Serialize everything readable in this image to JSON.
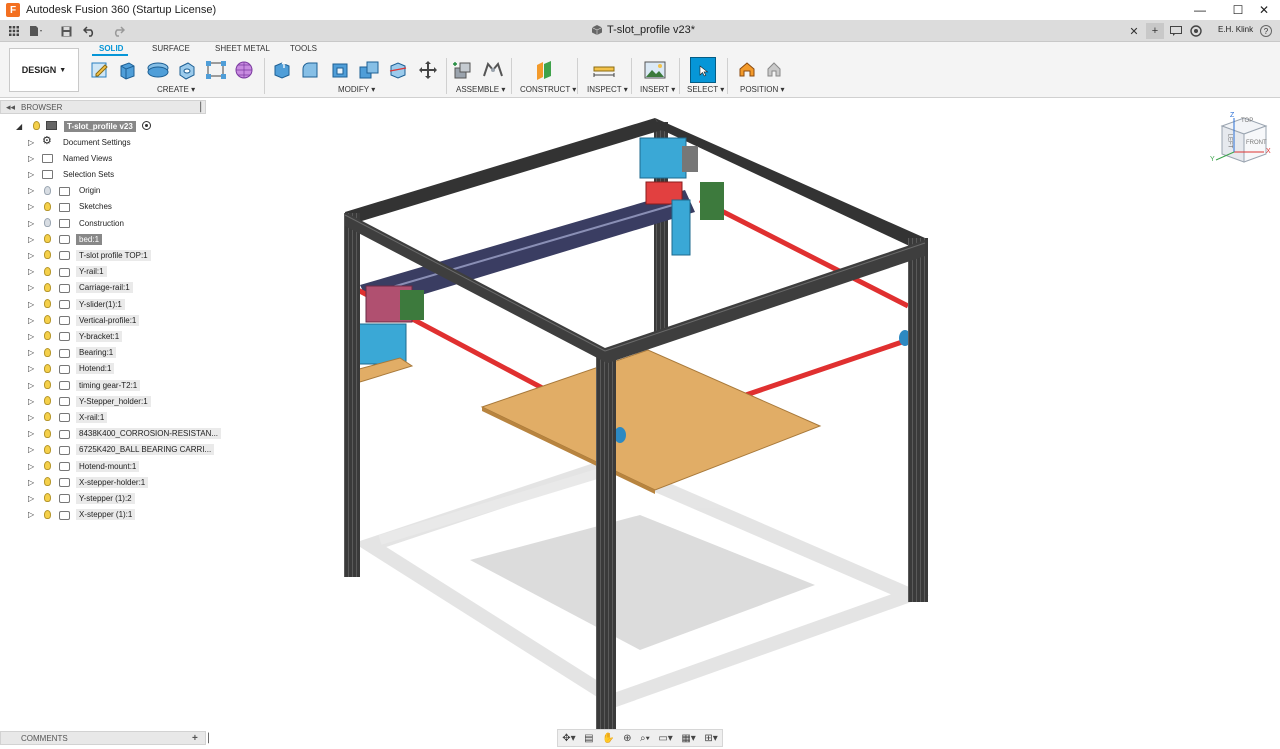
{
  "window": {
    "app_title": "Autodesk Fusion 360 (Startup License)",
    "logo_letter": "F",
    "controls": {
      "minimize": "—",
      "maximize": "☐",
      "close": "✕"
    }
  },
  "qat": {
    "document_tab": "T-slot_profile v23*",
    "tab_close": "✕",
    "tab_add": "+",
    "user_name": "E.H. Klink",
    "help_icon": "?"
  },
  "toolbar": {
    "workspace": "DESIGN",
    "tabs": [
      "SOLID",
      "SURFACE",
      "SHEET METAL",
      "TOOLS"
    ],
    "groups": {
      "create": "CREATE",
      "modify": "MODIFY",
      "assemble": "ASSEMBLE",
      "construct": "CONSTRUCT",
      "inspect": "INSPECT",
      "insert": "INSERT",
      "select": "SELECT",
      "position": "POSITION"
    },
    "accent_color": "#0696d7"
  },
  "browser": {
    "title": "BROWSER",
    "root": "T-slot_profile v23",
    "items": [
      {
        "label": "Document Settings"
      },
      {
        "label": "Named Views"
      },
      {
        "label": "Selection Sets"
      },
      {
        "label": "Origin"
      },
      {
        "label": "Sketches"
      },
      {
        "label": "Construction"
      },
      {
        "label": "bed:1"
      },
      {
        "label": "T-slot profile TOP:1"
      },
      {
        "label": "Y-rail:1"
      },
      {
        "label": "Carriage-rail:1"
      },
      {
        "label": "Y-slider(1):1"
      },
      {
        "label": "Vertical-profile:1"
      },
      {
        "label": "Y-bracket:1"
      },
      {
        "label": "Bearing:1"
      },
      {
        "label": "Hotend:1"
      },
      {
        "label": "timing gear-T2:1"
      },
      {
        "label": "Y-Stepper_holder:1"
      },
      {
        "label": "X-rail:1"
      },
      {
        "label": "8438K400_CORROSION-RESISTAN..."
      },
      {
        "label": "6725K420_BALL BEARING CARRI..."
      },
      {
        "label": "Hotend-mount:1"
      },
      {
        "label": "X-stepper-holder:1"
      },
      {
        "label": "Y-stepper (1):2"
      },
      {
        "label": "X-stepper (1):1"
      }
    ]
  },
  "comments": {
    "title": "COMMENTS",
    "add": "+"
  },
  "viewcube": {
    "top": "TOP",
    "front": "FRONT",
    "left": "LEFT",
    "x": "X",
    "y": "Y",
    "z": "Z"
  },
  "nav_bar": {
    "icons": [
      "orbit-icon",
      "look-at-icon",
      "pan-icon",
      "zoom-icon",
      "fit-icon",
      "display-settings-icon",
      "grid-icon",
      "viewports-icon"
    ]
  }
}
